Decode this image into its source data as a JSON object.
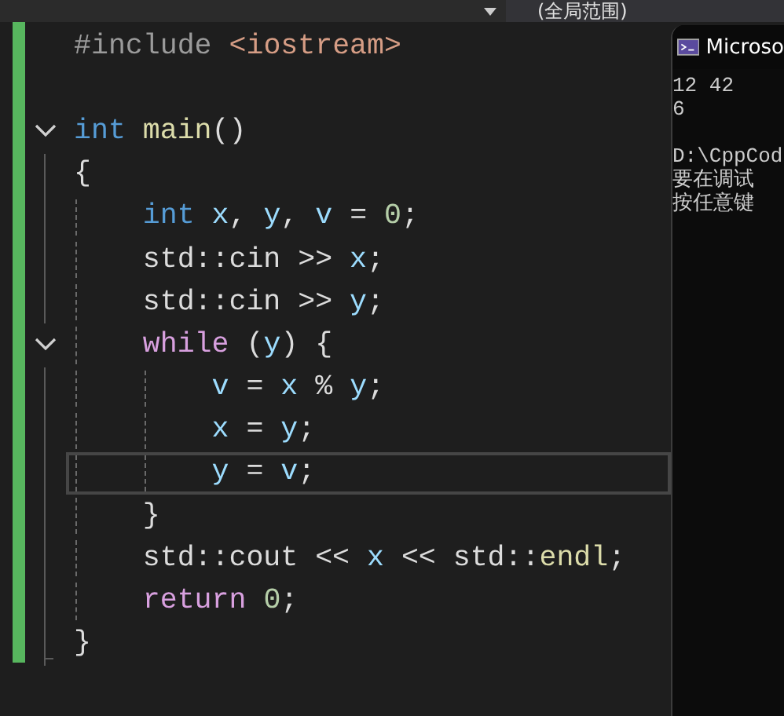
{
  "scope_bar": {
    "scope": "(全局范围)"
  },
  "editor": {
    "lines": [
      {
        "kind": "code",
        "current": false,
        "tokens": [
          {
            "text": "#include ",
            "kind": "preproc"
          },
          {
            "text": "<iostream>",
            "kind": "string"
          }
        ]
      },
      {
        "kind": "blank",
        "current": false
      },
      {
        "kind": "code",
        "current": false,
        "fold": {
          "expanded": true
        },
        "tokens": [
          {
            "text": "int ",
            "kind": "keyword"
          },
          {
            "text": "main",
            "kind": "func"
          },
          {
            "text": "()",
            "kind": "plain"
          }
        ]
      },
      {
        "kind": "code",
        "current": false,
        "tokens": [
          {
            "text": "{",
            "kind": "plain"
          }
        ]
      },
      {
        "kind": "code",
        "current": false,
        "tokens": [
          {
            "text": "    int ",
            "kind": "keyword"
          },
          {
            "text": "x",
            "kind": "var"
          },
          {
            "text": ", ",
            "kind": "plain"
          },
          {
            "text": "y",
            "kind": "var"
          },
          {
            "text": ", ",
            "kind": "plain"
          },
          {
            "text": "v",
            "kind": "var"
          },
          {
            "text": " = ",
            "kind": "plain"
          },
          {
            "text": "0",
            "kind": "number"
          },
          {
            "text": ";",
            "kind": "plain"
          }
        ]
      },
      {
        "kind": "code",
        "current": false,
        "tokens": [
          {
            "text": "    std::cin >> ",
            "kind": "plain"
          },
          {
            "text": "x",
            "kind": "var"
          },
          {
            "text": ";",
            "kind": "plain"
          }
        ]
      },
      {
        "kind": "code",
        "current": false,
        "tokens": [
          {
            "text": "    std::cin >> ",
            "kind": "plain"
          },
          {
            "text": "y",
            "kind": "var"
          },
          {
            "text": ";",
            "kind": "plain"
          }
        ]
      },
      {
        "kind": "code",
        "current": false,
        "fold": {
          "expanded": true
        },
        "tokens": [
          {
            "text": "    while",
            "kind": "control"
          },
          {
            "text": " (",
            "kind": "plain"
          },
          {
            "text": "y",
            "kind": "var"
          },
          {
            "text": ") {",
            "kind": "plain"
          }
        ]
      },
      {
        "kind": "code",
        "current": false,
        "tokens": [
          {
            "text": "        v",
            "kind": "var"
          },
          {
            "text": " = ",
            "kind": "plain"
          },
          {
            "text": "x",
            "kind": "var"
          },
          {
            "text": " % ",
            "kind": "plain"
          },
          {
            "text": "y",
            "kind": "var"
          },
          {
            "text": ";",
            "kind": "plain"
          }
        ]
      },
      {
        "kind": "code",
        "current": false,
        "tokens": [
          {
            "text": "        x",
            "kind": "var"
          },
          {
            "text": " = ",
            "kind": "plain"
          },
          {
            "text": "y",
            "kind": "var"
          },
          {
            "text": ";",
            "kind": "plain"
          }
        ]
      },
      {
        "kind": "code",
        "current": true,
        "tokens": [
          {
            "text": "        y",
            "kind": "var"
          },
          {
            "text": " = ",
            "kind": "plain"
          },
          {
            "text": "v",
            "kind": "var"
          },
          {
            "text": ";",
            "kind": "plain"
          }
        ]
      },
      {
        "kind": "code",
        "current": false,
        "tokens": [
          {
            "text": "    }",
            "kind": "plain"
          }
        ]
      },
      {
        "kind": "code",
        "current": false,
        "tokens": [
          {
            "text": "    std::cout << ",
            "kind": "plain"
          },
          {
            "text": "x",
            "kind": "var"
          },
          {
            "text": " << std::",
            "kind": "plain"
          },
          {
            "text": "endl",
            "kind": "func"
          },
          {
            "text": ";",
            "kind": "plain"
          }
        ]
      },
      {
        "kind": "code",
        "current": false,
        "tokens": [
          {
            "text": "    return ",
            "kind": "control"
          },
          {
            "text": "0",
            "kind": "number"
          },
          {
            "text": ";",
            "kind": "plain"
          }
        ]
      },
      {
        "kind": "code",
        "current": false,
        "tokens": [
          {
            "text": "}",
            "kind": "plain"
          }
        ]
      }
    ]
  },
  "console": {
    "title": "Microso",
    "blocks": [
      [
        "12 42",
        "6"
      ],
      [
        "D:\\CppCod",
        "要在调试",
        "按任意键"
      ]
    ]
  }
}
